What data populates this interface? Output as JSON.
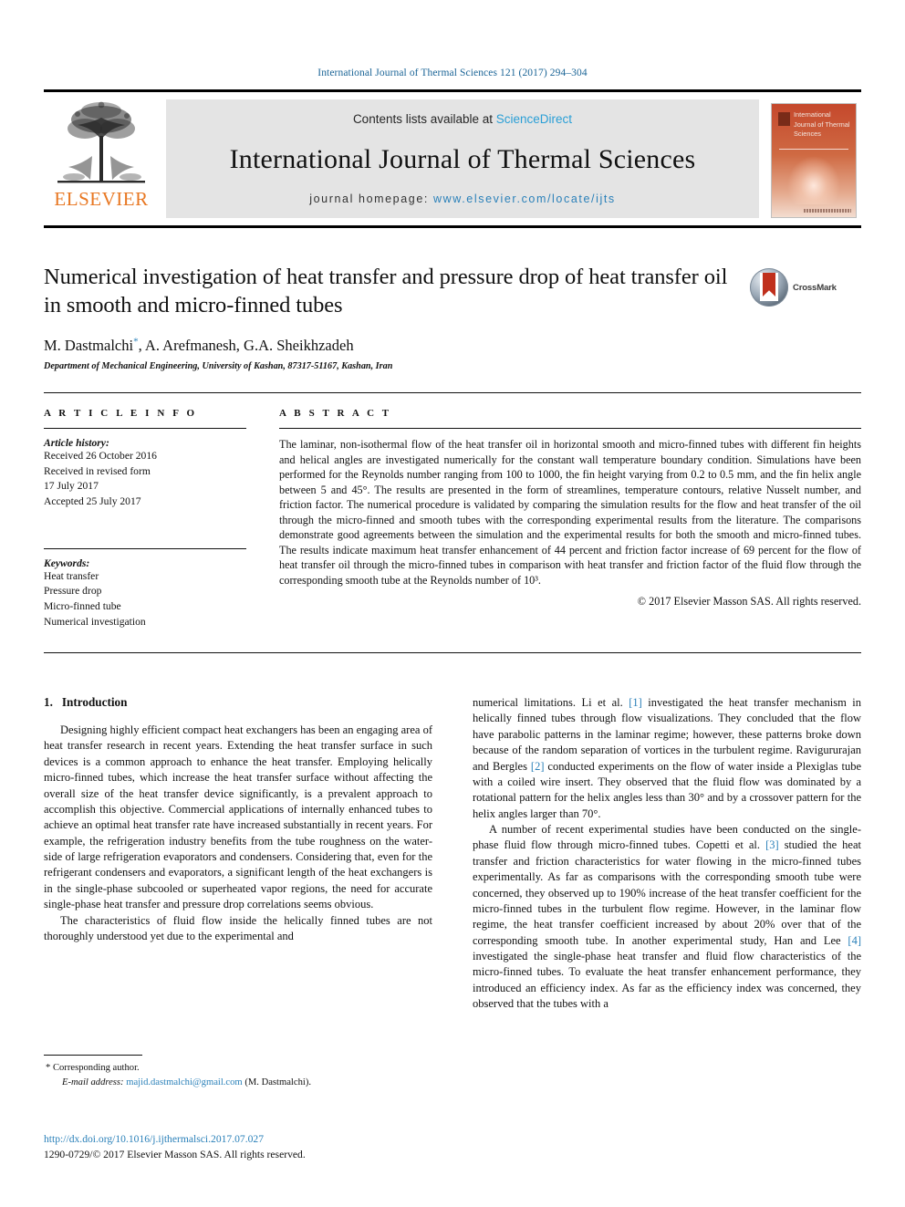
{
  "running_head": "International Journal of Thermal Sciences 121 (2017) 294–304",
  "masthead": {
    "publisher_name": "ELSEVIER",
    "contents_prefix": "Contents lists available at ",
    "contents_link": "ScienceDirect",
    "journal_title": "International Journal of Thermal Sciences",
    "homepage_prefix": "journal homepage: ",
    "homepage_url": "www.elsevier.com/locate/ijts",
    "cover_title": "International Journal of Thermal Sciences"
  },
  "article": {
    "title": "Numerical investigation of heat transfer and pressure drop of heat transfer oil in smooth and micro-finned tubes",
    "authors": "M. Dastmalchi, A. Arefmanesh, G.A. Sheikhzadeh",
    "author_star": "*",
    "affiliation": "Department of Mechanical Engineering, University of Kashan, 87317-51167, Kashan, Iran",
    "crossmark_label": "CrossMark"
  },
  "info": {
    "heading": "A R T I C L E   I N F O",
    "history_label": "Article history:",
    "history_lines": [
      "Received 26 October 2016",
      "Received in revised form",
      "17 July 2017",
      "Accepted 25 July 2017"
    ],
    "keywords_label": "Keywords:",
    "keywords": [
      "Heat transfer",
      "Pressure drop",
      "Micro-finned tube",
      "Numerical investigation"
    ]
  },
  "abstract": {
    "heading": "A B S T R A C T",
    "text": "The laminar, non-isothermal flow of the heat transfer oil in horizontal smooth and micro-finned tubes with different fin heights and helical angles are investigated numerically for the constant wall temperature boundary condition. Simulations have been performed for the Reynolds number ranging from 100 to 1000, the fin height varying from 0.2 to 0.5 mm, and the fin helix angle between 5 and 45°. The results are presented in the form of streamlines, temperature contours, relative Nusselt number, and friction factor. The numerical procedure is validated by comparing the simulation results for the flow and heat transfer of the oil through the micro-finned and smooth tubes with the corresponding experimental results from the literature. The comparisons demonstrate good agreements between the simulation and the experimental results for both the smooth and micro-finned tubes. The results indicate maximum heat transfer enhancement of 44 percent and friction factor increase of 69 percent for the flow of heat transfer oil through the micro-finned tubes in comparison with heat transfer and friction factor of the fluid flow through the corresponding smooth tube at the Reynolds number of 10³.",
    "copyright": "© 2017 Elsevier Masson SAS. All rights reserved."
  },
  "body": {
    "section_number": "1.",
    "section_title": "Introduction",
    "left_paragraphs": [
      "Designing highly efficient compact heat exchangers has been an engaging area of heat transfer research in recent years. Extending the heat transfer surface in such devices is a common approach to enhance the heat transfer. Employing helically micro-finned tubes, which increase the heat transfer surface without affecting the overall size of the heat transfer device significantly, is a prevalent approach to accomplish this objective. Commercial applications of internally enhanced tubes to achieve an optimal heat transfer rate have increased substantially in recent years. For example, the refrigeration industry benefits from the tube roughness on the water-side of large refrigeration evaporators and condensers. Considering that, even for the refrigerant condensers and evaporators, a significant length of the heat exchangers is in the single-phase subcooled or superheated vapor regions, the need for accurate single-phase heat transfer and pressure drop correlations seems obvious.",
      "The characteristics of fluid flow inside the helically finned tubes are not thoroughly understood yet due to the experimental and"
    ],
    "right_paragraph_1_parts": [
      "numerical limitations. Li et al. ",
      "[1]",
      " investigated the heat transfer mechanism in helically finned tubes through flow visualizations. They concluded that the flow have parabolic patterns in the laminar regime; however, these patterns broke down because of the random separation of vortices in the turbulent regime. Ravigururajan and Bergles ",
      "[2]",
      " conducted experiments on the flow of water inside a Plexiglas tube with a coiled wire insert. They observed that the fluid flow was dominated by a rotational pattern for the helix angles less than 30° and by a crossover pattern for the helix angles larger than 70°."
    ],
    "right_paragraph_2_parts": [
      "A number of recent experimental studies have been conducted on the single-phase fluid flow through micro-finned tubes. Copetti et al. ",
      "[3]",
      " studied the heat transfer and friction characteristics for water flowing in the micro-finned tubes experimentally. As far as comparisons with the corresponding smooth tube were concerned, they observed up to 190% increase of the heat transfer coefficient for the micro-finned tubes in the turbulent flow regime. However, in the laminar flow regime, the heat transfer coefficient increased by about 20% over that of the corresponding smooth tube. In another experimental study, Han and Lee ",
      "[4]",
      " investigated the single-phase heat transfer and fluid flow characteristics of the micro-finned tubes. To evaluate the heat transfer enhancement performance, they introduced an efficiency index. As far as the efficiency index was concerned, they observed that the tubes with a"
    ]
  },
  "footnote": {
    "corresponding": "* Corresponding author.",
    "email_label": "E-mail address:",
    "email": "majid.dastmalchi@gmail.com",
    "email_suffix": "(M. Dastmalchi)."
  },
  "publication": {
    "doi": "http://dx.doi.org/10.1016/j.ijthermalsci.2017.07.027",
    "issn_line": "1290-0729/© 2017 Elsevier Masson SAS. All rights reserved."
  },
  "colors": {
    "link_blue": "#2a80b9",
    "running_head_blue": "#1a6496",
    "elsevier_orange": "#e87722",
    "band_gray": "#e4e4e4",
    "crossmark_red": "#c0301d"
  }
}
